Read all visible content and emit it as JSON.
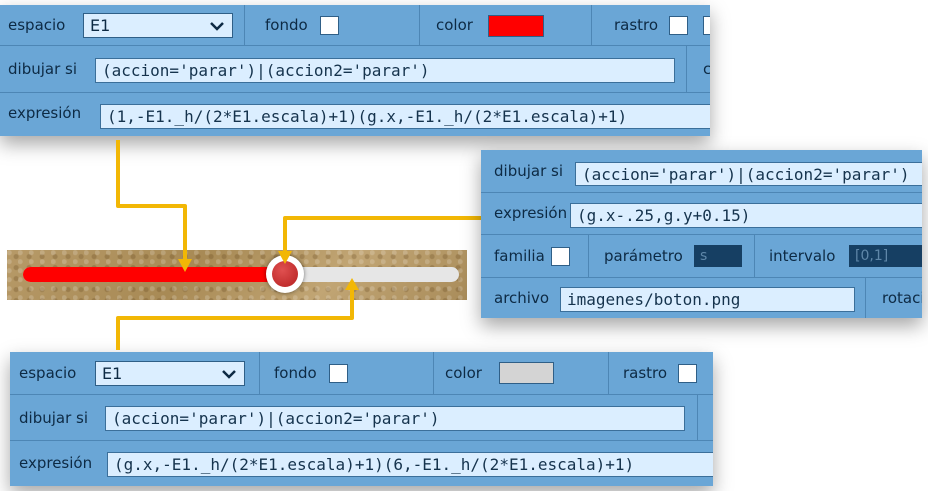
{
  "colors": {
    "panel_bg": "#6aa6d6",
    "connector": "#f2b705",
    "slider_fill": "#ff0000",
    "slider_knob": "#c62828"
  },
  "top_panel": {
    "row1": {
      "espacio_label": "espacio",
      "espacio_value": "E1",
      "fondo_label": "fondo",
      "color_label": "color",
      "color_value": "#ff0000",
      "rastro_label": "rastro"
    },
    "row2": {
      "label": "dibujar si",
      "value": "(accion='parar')|(accion2='parar')",
      "clipped": "c"
    },
    "row3": {
      "label": "expresión",
      "value": "(1,-E1._h/(2*E1.escala)+1)(g.x,-E1._h/(2*E1.escala)+1)"
    }
  },
  "right_panel": {
    "row1": {
      "label": "dibujar si",
      "value": "(accion='parar')|(accion2='parar')"
    },
    "row2": {
      "label": "expresión",
      "value": "(g.x-.25,g.y+0.15)"
    },
    "row3": {
      "familia_label": "familia",
      "parametro_label": "parámetro",
      "parametro_value": "s",
      "intervalo_label": "intervalo",
      "intervalo_value": "[0,1]"
    },
    "row4": {
      "archivo_label": "archivo",
      "archivo_value": "imagenes/boton.png",
      "rotacion_label": "rotaci"
    }
  },
  "bottom_panel": {
    "row1": {
      "espacio_label": "espacio",
      "espacio_value": "E1",
      "fondo_label": "fondo",
      "color_label": "color",
      "color_value": "#d4d4d4",
      "rastro_label": "rastro"
    },
    "row2": {
      "label": "dibujar si",
      "value": "(accion='parar')|(accion2='parar')"
    },
    "row3": {
      "label": "expresión",
      "value": "(g.x,-E1._h/(2*E1.escala)+1)(6,-E1._h/(2*E1.escala)+1)"
    }
  },
  "slider": {
    "progress_percent": 60
  }
}
